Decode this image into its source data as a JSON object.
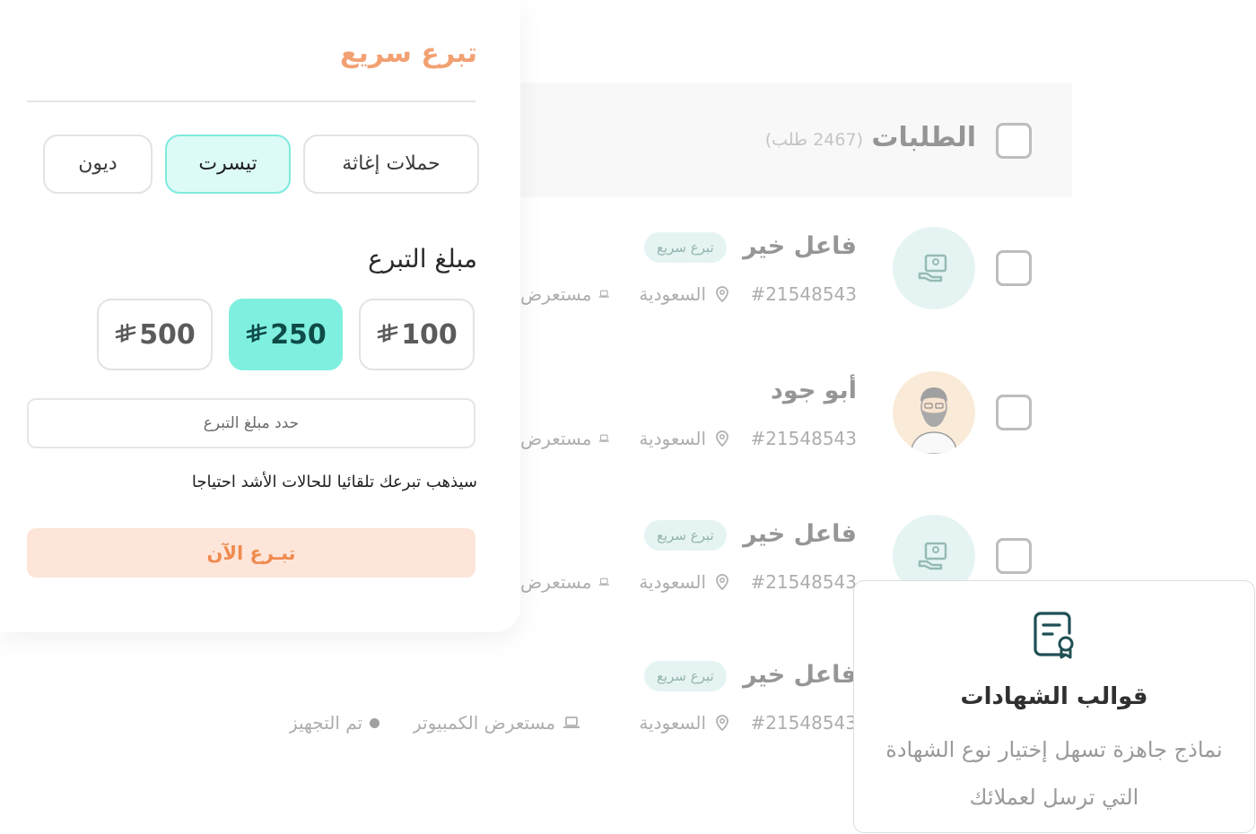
{
  "requests": {
    "title": "الطلبات",
    "count_label": "(2467 طلب)",
    "rows": [
      {
        "name": "فاعل خير",
        "badge": "تبرع سريع",
        "id": "#21548543",
        "location": "السعودية",
        "device": "مستعرض",
        "avatar": "hand-donation-icon"
      },
      {
        "name": "أبو جود",
        "badge": "",
        "id": "#21548543",
        "location": "السعودية",
        "device": "مستعرض",
        "avatar": "person-avatar"
      },
      {
        "name": "فاعل خير",
        "badge": "تبرع سريع",
        "id": "#21548543",
        "location": "السعودية",
        "device": "مستعرض",
        "avatar": "hand-donation-icon"
      },
      {
        "name": "فاعل خير",
        "badge": "تبرع سريع",
        "id": "#21548543",
        "location": "السعودية",
        "device": "مستعرض الكمبيوتر",
        "status": "تم التجهيز",
        "avatar": "hand-donation-icon"
      }
    ]
  },
  "quick_donation": {
    "title": "تبرع سريع",
    "categories": [
      "حملات إغاثة",
      "تيسرت",
      "ديون"
    ],
    "active_category": "تيسرت",
    "amount_label": "مبلغ التبرع",
    "amounts": [
      "100",
      "250",
      "500"
    ],
    "active_amount": "250",
    "currency_icon": "saudi-riyal-icon",
    "amount_placeholder": "حدد مبلغ التبرع",
    "note": "سيذهب تبرعك تلقائيا للحالات الأشد احتياجا",
    "donate_button": "تبـرع الآن"
  },
  "certificates": {
    "icon": "certificate-icon",
    "title": "قوالب الشهادات",
    "description": "نماذج جاهزة تسهل إختيار نوع الشهادة التي ترسل لعملائك"
  },
  "colors": {
    "accent_orange": "#f2a173",
    "accent_teal": "#7ff0df",
    "teal_light": "#dcfaf6",
    "badge_bg": "#cdebe6",
    "button_bg": "#fde5d9"
  }
}
